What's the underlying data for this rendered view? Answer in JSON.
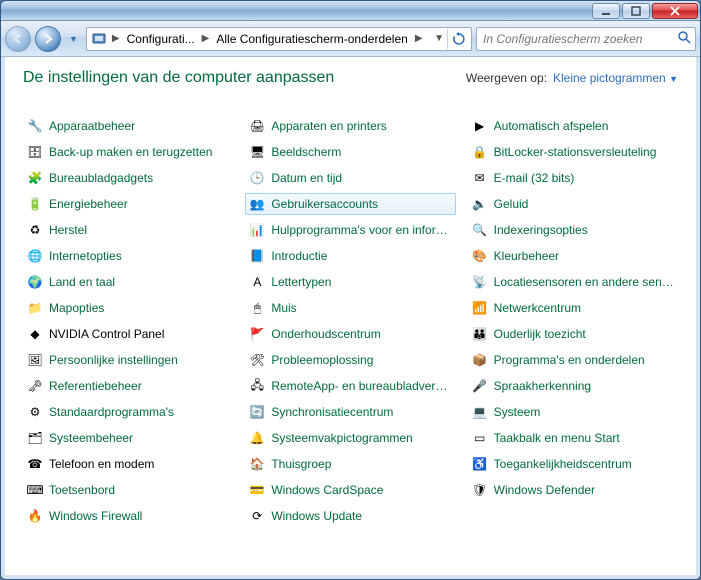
{
  "titlebar": {},
  "breadcrumb": {
    "seg1": "Configurati...",
    "seg2": "Alle Configuratiescherm-onderdelen"
  },
  "search": {
    "placeholder": "In Configuratiescherm zoeken"
  },
  "header": {
    "title": "De instellingen van de computer aanpassen",
    "view_label": "Weergeven op:",
    "view_mode": "Kleine pictogrammen"
  },
  "selected_index": 10,
  "items": [
    {
      "label": "Apparaatbeheer",
      "icon": "device-manager-icon",
      "glyph": "🔧",
      "black": false
    },
    {
      "label": "Apparaten en printers",
      "icon": "devices-printers-icon",
      "glyph": "🖨",
      "black": false
    },
    {
      "label": "Automatisch afspelen",
      "icon": "autoplay-icon",
      "glyph": "▶",
      "black": false
    },
    {
      "label": "Back-up maken en terugzetten",
      "icon": "backup-icon",
      "glyph": "🗄",
      "black": false
    },
    {
      "label": "Beeldscherm",
      "icon": "display-icon",
      "glyph": "🖥",
      "black": false
    },
    {
      "label": "BitLocker-stationsversleuteling",
      "icon": "bitlocker-icon",
      "glyph": "🔒",
      "black": false
    },
    {
      "label": "Bureaubladgadgets",
      "icon": "gadgets-icon",
      "glyph": "🧩",
      "black": false
    },
    {
      "label": "Datum en tijd",
      "icon": "datetime-icon",
      "glyph": "🕒",
      "black": false
    },
    {
      "label": "E-mail (32 bits)",
      "icon": "mail-icon",
      "glyph": "✉",
      "black": false
    },
    {
      "label": "Energiebeheer",
      "icon": "power-icon",
      "glyph": "🔋",
      "black": false
    },
    {
      "label": "Gebruikersaccounts",
      "icon": "user-accounts-icon",
      "glyph": "👥",
      "black": false
    },
    {
      "label": "Geluid",
      "icon": "sound-icon",
      "glyph": "🔈",
      "black": false
    },
    {
      "label": "Herstel",
      "icon": "recovery-icon",
      "glyph": "♻",
      "black": false
    },
    {
      "label": "Hulpprogramma's voor en informati..",
      "icon": "admin-tools-icon",
      "glyph": "📊",
      "black": false
    },
    {
      "label": "Indexeringsopties",
      "icon": "indexing-icon",
      "glyph": "🔍",
      "black": false
    },
    {
      "label": "Internetopties",
      "icon": "internet-options-icon",
      "glyph": "🌐",
      "black": false
    },
    {
      "label": "Introductie",
      "icon": "getting-started-icon",
      "glyph": "📘",
      "black": false
    },
    {
      "label": "Kleurbeheer",
      "icon": "color-management-icon",
      "glyph": "🎨",
      "black": false
    },
    {
      "label": "Land en taal",
      "icon": "region-language-icon",
      "glyph": "🌍",
      "black": false
    },
    {
      "label": "Lettertypen",
      "icon": "fonts-icon",
      "glyph": "A",
      "black": false
    },
    {
      "label": "Locatiesensoren en andere sensoren",
      "icon": "sensors-icon",
      "glyph": "📡",
      "black": false
    },
    {
      "label": "Mapopties",
      "icon": "folder-options-icon",
      "glyph": "📁",
      "black": false
    },
    {
      "label": "Muis",
      "icon": "mouse-icon",
      "glyph": "🖱",
      "black": false
    },
    {
      "label": "Netwerkcentrum",
      "icon": "network-center-icon",
      "glyph": "📶",
      "black": false
    },
    {
      "label": "NVIDIA Control Panel",
      "icon": "nvidia-icon",
      "glyph": "◆",
      "black": true
    },
    {
      "label": "Onderhoudscentrum",
      "icon": "action-center-icon",
      "glyph": "🚩",
      "black": false
    },
    {
      "label": "Ouderlijk toezicht",
      "icon": "parental-controls-icon",
      "glyph": "👪",
      "black": false
    },
    {
      "label": "Persoonlijke instellingen",
      "icon": "personalization-icon",
      "glyph": "🖼",
      "black": false
    },
    {
      "label": "Probleemoplossing",
      "icon": "troubleshooting-icon",
      "glyph": "🛠",
      "black": false
    },
    {
      "label": "Programma's en onderdelen",
      "icon": "programs-features-icon",
      "glyph": "📦",
      "black": false
    },
    {
      "label": "Referentiebeheer",
      "icon": "credential-manager-icon",
      "glyph": "🗝",
      "black": false
    },
    {
      "label": "RemoteApp- en bureaubladverbindi...",
      "icon": "remoteapp-icon",
      "glyph": "🖧",
      "black": false
    },
    {
      "label": "Spraakherkenning",
      "icon": "speech-icon",
      "glyph": "🎤",
      "black": false
    },
    {
      "label": "Standaardprogramma's",
      "icon": "default-programs-icon",
      "glyph": "⚙",
      "black": false
    },
    {
      "label": "Synchronisatiecentrum",
      "icon": "sync-center-icon",
      "glyph": "🔄",
      "black": false
    },
    {
      "label": "Systeem",
      "icon": "system-icon",
      "glyph": "💻",
      "black": false
    },
    {
      "label": "Systeembeheer",
      "icon": "admin-tools-icon",
      "glyph": "🗂",
      "black": false
    },
    {
      "label": "Systeemvakpictogrammen",
      "icon": "notification-icons-icon",
      "glyph": "🔔",
      "black": false
    },
    {
      "label": "Taakbalk en menu Start",
      "icon": "taskbar-start-icon",
      "glyph": "▭",
      "black": false
    },
    {
      "label": "Telefoon en modem",
      "icon": "phone-modem-icon",
      "glyph": "☎",
      "black": true
    },
    {
      "label": "Thuisgroep",
      "icon": "homegroup-icon",
      "glyph": "🏠",
      "black": false
    },
    {
      "label": "Toegankelijkheidscentrum",
      "icon": "ease-of-access-icon",
      "glyph": "♿",
      "black": false
    },
    {
      "label": "Toetsenbord",
      "icon": "keyboard-icon",
      "glyph": "⌨",
      "black": false
    },
    {
      "label": "Windows CardSpace",
      "icon": "cardspace-icon",
      "glyph": "💳",
      "black": false
    },
    {
      "label": "Windows Defender",
      "icon": "defender-icon",
      "glyph": "🛡",
      "black": false
    },
    {
      "label": "Windows Firewall",
      "icon": "firewall-icon",
      "glyph": "🔥",
      "black": false
    },
    {
      "label": "Windows Update",
      "icon": "windows-update-icon",
      "glyph": "⟳",
      "black": false
    }
  ]
}
